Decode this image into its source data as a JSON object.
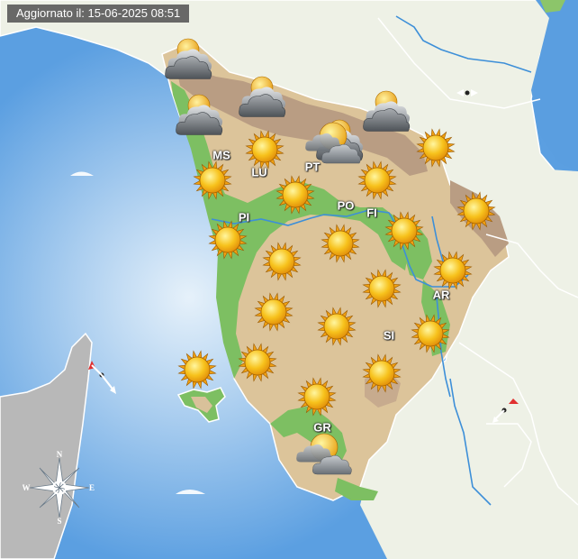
{
  "timestamp": {
    "label": "Aggiornato il:",
    "date": "15-06-2025",
    "time": "08:51"
  },
  "provinces": [
    {
      "code": "MS"
    },
    {
      "code": "LU"
    },
    {
      "code": "PT"
    },
    {
      "code": "PO"
    },
    {
      "code": "FI"
    },
    {
      "code": "PI"
    },
    {
      "code": "AR"
    },
    {
      "code": "SI"
    },
    {
      "code": "GR"
    }
  ],
  "forecast_icons": [
    "cloudy-icon",
    "cloudy-icon",
    "cloudy-icon",
    "cloudy-icon",
    "cloudy-icon",
    "partly-cloudy-icon",
    "partly-cloudy-icon",
    "sunny-icon",
    "sunny-icon",
    "sunny-icon",
    "sunny-icon",
    "sunny-icon",
    "sunny-icon",
    "sunny-icon",
    "sunny-icon",
    "sunny-icon",
    "sunny-icon",
    "sunny-icon",
    "sunny-icon",
    "sunny-icon",
    "sunny-icon",
    "sunny-icon",
    "sunny-icon",
    "sunny-icon",
    "sunny-icon",
    "sunny-icon"
  ],
  "compass": {
    "n": "N",
    "s": "S",
    "e": "E",
    "w": "W"
  },
  "colors": {
    "sea": "#5a9ee0",
    "sea_light": "#dcecf7",
    "land_outside": "#eef1e8",
    "corsica": "#b8b8b8",
    "tuscany_hills": "#dcc49a",
    "lowlands": "#7dbf62",
    "mountains": "#b79a80",
    "rivers": "#3d8fd8"
  }
}
